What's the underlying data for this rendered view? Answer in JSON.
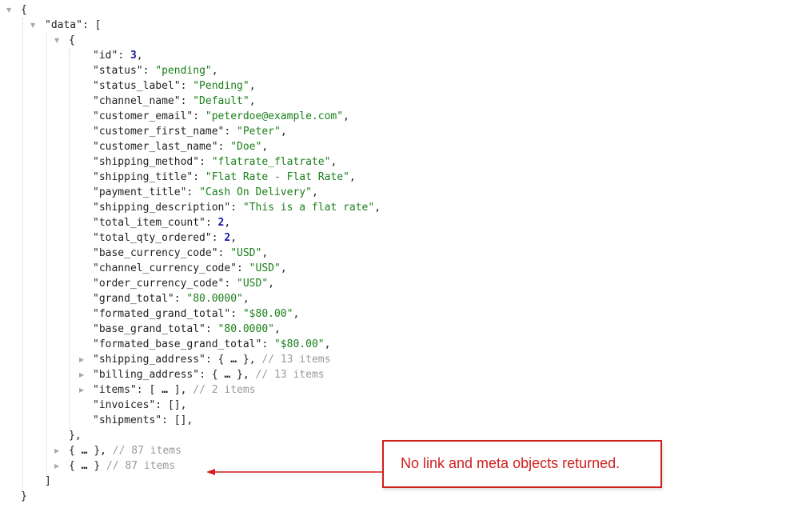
{
  "json_viewer": {
    "root_open": "{",
    "data_key": "\"data\"",
    "data_open": ": [",
    "first_item_open": "{",
    "fields": [
      {
        "key": "\"id\"",
        "value": "3",
        "type": "num"
      },
      {
        "key": "\"status\"",
        "value": "\"pending\"",
        "type": "str"
      },
      {
        "key": "\"status_label\"",
        "value": "\"Pending\"",
        "type": "str"
      },
      {
        "key": "\"channel_name\"",
        "value": "\"Default\"",
        "type": "str"
      },
      {
        "key": "\"customer_email\"",
        "value": "\"peterdoe@example.com\"",
        "type": "str"
      },
      {
        "key": "\"customer_first_name\"",
        "value": "\"Peter\"",
        "type": "str"
      },
      {
        "key": "\"customer_last_name\"",
        "value": "\"Doe\"",
        "type": "str"
      },
      {
        "key": "\"shipping_method\"",
        "value": "\"flatrate_flatrate\"",
        "type": "str"
      },
      {
        "key": "\"shipping_title\"",
        "value": "\"Flat Rate - Flat Rate\"",
        "type": "str"
      },
      {
        "key": "\"payment_title\"",
        "value": "\"Cash On Delivery\"",
        "type": "str"
      },
      {
        "key": "\"shipping_description\"",
        "value": "\"This is a flat rate\"",
        "type": "str"
      },
      {
        "key": "\"total_item_count\"",
        "value": "2",
        "type": "num"
      },
      {
        "key": "\"total_qty_ordered\"",
        "value": "2",
        "type": "num"
      },
      {
        "key": "\"base_currency_code\"",
        "value": "\"USD\"",
        "type": "str"
      },
      {
        "key": "\"channel_currency_code\"",
        "value": "\"USD\"",
        "type": "str"
      },
      {
        "key": "\"order_currency_code\"",
        "value": "\"USD\"",
        "type": "str"
      },
      {
        "key": "\"grand_total\"",
        "value": "\"80.0000\"",
        "type": "str"
      },
      {
        "key": "\"formated_grand_total\"",
        "value": "\"$80.00\"",
        "type": "str"
      },
      {
        "key": "\"base_grand_total\"",
        "value": "\"80.0000\"",
        "type": "str"
      },
      {
        "key": "\"formated_base_grand_total\"",
        "value": "\"$80.00\"",
        "type": "str"
      }
    ],
    "collapsed_fields": [
      {
        "key": "\"shipping_address\"",
        "open": "{",
        "close": "}",
        "comment": "// 13 items"
      },
      {
        "key": "\"billing_address\"",
        "open": "{",
        "close": "}",
        "comment": "// 13 items"
      },
      {
        "key": "\"items\"",
        "open": "[",
        "close": "]",
        "comment": "// 2 items"
      }
    ],
    "empty_fields": [
      {
        "key": "\"invoices\"",
        "value": "[]"
      },
      {
        "key": "\"shipments\"",
        "value": "[]"
      }
    ],
    "first_item_close": "},",
    "collapsed_items": [
      {
        "open": "{",
        "close": "}",
        "trail": ",",
        "comment": "// 87 items"
      },
      {
        "open": "{",
        "close": "}",
        "trail": "",
        "comment": "// 87 items"
      }
    ],
    "ellipsis": "…",
    "data_close": "]",
    "root_close": "}",
    "toggle_open_glyph": "▼",
    "toggle_closed_glyph": "▶"
  },
  "annotation": {
    "text": "No link and meta objects returned.",
    "color": "#d01f1f"
  }
}
